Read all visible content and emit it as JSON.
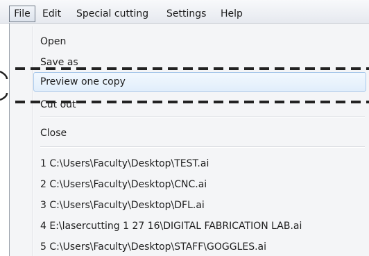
{
  "menubar": {
    "file": "File",
    "edit": "Edit",
    "special_cutting": "Special cutting",
    "settings": "Settings",
    "help": "Help"
  },
  "file_menu": {
    "open": "Open",
    "save_as": "Save as",
    "preview_one_copy": "Preview one copy",
    "cut_out": "Cut out",
    "close": "Close",
    "recent_files": [
      "1 C:\\Users\\Faculty\\Desktop\\TEST.ai",
      "2 C:\\Users\\Faculty\\Desktop\\CNC.ai",
      "3 C:\\Users\\Faculty\\Desktop\\DFL.ai",
      "4 E:\\lasercutting 1 27 16\\DIGITAL FABRICATION LAB.ai",
      "5 C:\\Users\\Faculty\\Desktop\\STAFF\\GOGGLES.ai"
    ]
  },
  "annotation": {
    "highlighted_item": "Preview one copy",
    "style": "dashed",
    "color": "#222222"
  },
  "colors": {
    "hover_border": "#a8c8ea",
    "hover_fill": "#e6f0fb",
    "menu_background": "#f4f5f7"
  }
}
